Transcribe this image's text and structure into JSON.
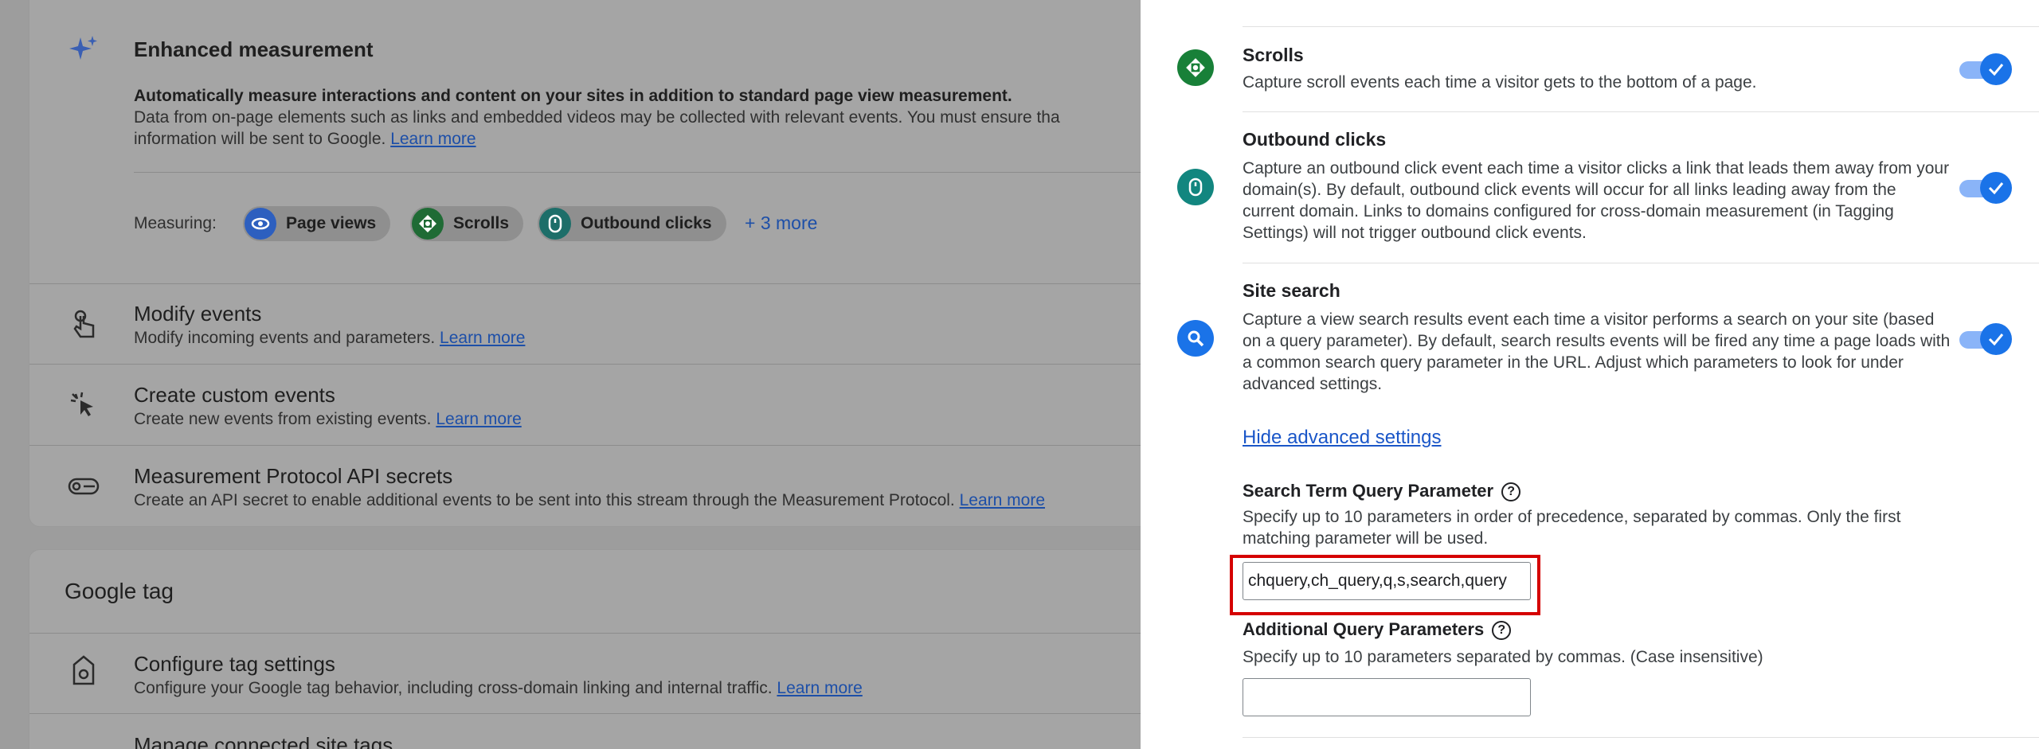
{
  "left": {
    "enhanced": {
      "title": "Enhanced measurement",
      "desc_bold": "Automatically measure interactions and content on your sites in addition to standard page view measurement.",
      "desc_1": "Data from on-page elements such as links and embedded videos may be collected with relevant events. You must ensure tha",
      "desc_2": "information will be sent to Google.",
      "learn_more": "Learn more",
      "measuring_label": "Measuring:",
      "chips": [
        "Page views",
        "Scrolls",
        "Outbound clicks"
      ],
      "more": "+ 3 more"
    },
    "rows": [
      {
        "title": "Modify events",
        "desc": "Modify incoming events and parameters.",
        "link": "Learn more"
      },
      {
        "title": "Create custom events",
        "desc": "Create new events from existing events.",
        "link": "Learn more"
      },
      {
        "title": "Measurement Protocol API secrets",
        "desc": "Create an API secret to enable additional events to be sent into this stream through the Measurement Protocol.",
        "link": "Learn more"
      }
    ],
    "google_tag": {
      "heading": "Google tag",
      "configure_title": "Configure tag settings",
      "configure_desc": "Configure your Google tag behavior, including cross-domain linking and internal traffic.",
      "configure_link": "Learn more",
      "manage_title": "Manage connected site tags"
    }
  },
  "drawer": {
    "scrolls": {
      "title": "Scrolls",
      "desc": "Capture scroll events each time a visitor gets to the bottom of a page."
    },
    "outbound": {
      "title": "Outbound clicks",
      "desc": "Capture an outbound click event each time a visitor clicks a link that leads them away from your domain(s). By default, outbound click events will occur for all links leading away from the current domain. Links to domains configured for cross-domain measurement (in Tagging Settings) will not trigger outbound click events."
    },
    "site_search": {
      "title": "Site search",
      "desc": "Capture a view search results event each time a visitor performs a search on your site (based on a query parameter). By default, search results events will be fired any time a page loads with a common search query parameter in the URL. Adjust which parameters to look for under advanced settings."
    },
    "hide_advanced": "Hide advanced settings",
    "search_term": {
      "label": "Search Term Query Parameter",
      "desc": "Specify up to 10 parameters in order of precedence, separated by commas. Only the first matching parameter will be used.",
      "value": "chquery,ch_query,q,s,search,query"
    },
    "additional": {
      "label": "Additional Query Parameters",
      "desc": "Specify up to 10 parameters separated by commas. (Case insensitive)",
      "value": ""
    },
    "help_glyph": "?"
  },
  "colors": {
    "accent": "#1a73e8",
    "green_icon": "#188038",
    "teal_icon": "#12867f",
    "highlight": "#d50000"
  }
}
